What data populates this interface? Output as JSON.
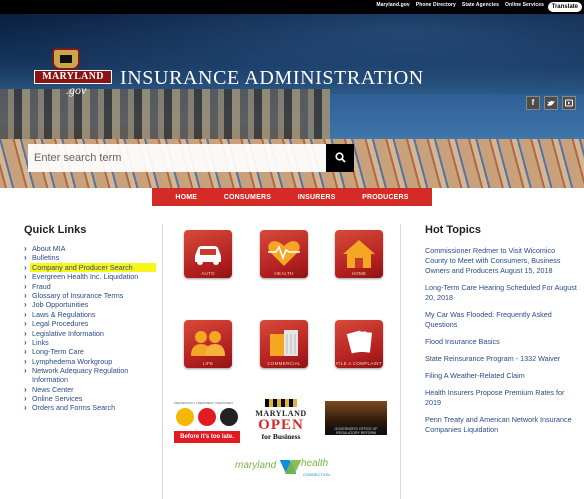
{
  "topbar": {
    "links": [
      "Maryland.gov",
      "Phone Directory",
      "State Agencies",
      "Online Services"
    ],
    "translate_label": "Translate"
  },
  "header": {
    "logo": {
      "wordmark": "MARYLAND",
      "gov": ".gov"
    },
    "site_title": "INSURANCE ADMINISTRATION",
    "social": [
      "f",
      "t",
      "yt"
    ]
  },
  "search": {
    "placeholder": "Enter search term"
  },
  "nav": {
    "items": [
      "HOME",
      "CONSUMERS",
      "INSURERS",
      "PRODUCERS"
    ]
  },
  "quick_links": {
    "heading": "Quick Links",
    "items": [
      {
        "label": "About MIA"
      },
      {
        "label": "Bulletins"
      },
      {
        "label": "Company and Producer Search",
        "highlighted": true
      },
      {
        "label": "Evergreen Health Inc. Liquidation"
      },
      {
        "label": "Fraud"
      },
      {
        "label": "Glossary of Insurance Terms"
      },
      {
        "label": "Job Opportunities"
      },
      {
        "label": "Laws & Regulations"
      },
      {
        "label": "Legal Procedures"
      },
      {
        "label": "Legislative Information"
      },
      {
        "label": "Links"
      },
      {
        "label": "Long-Term Care"
      },
      {
        "label": "Lymphedema Workgroup"
      },
      {
        "label": "Network Adequacy Regulation Information"
      },
      {
        "label": "News Center"
      },
      {
        "label": "Online Services"
      },
      {
        "label": "Orders and Forms Search"
      }
    ]
  },
  "tiles": [
    {
      "label": "AUTO",
      "icon": "car-icon"
    },
    {
      "label": "HEALTH",
      "icon": "heart-icon"
    },
    {
      "label": "HOME",
      "icon": "house-icon"
    },
    {
      "label": "LIFE",
      "icon": "people-icon"
    },
    {
      "label": "COMMERCIAL",
      "icon": "building-icon"
    },
    {
      "label": "FILE A COMPLAINT",
      "icon": "documents-icon"
    }
  ],
  "partners": {
    "bubbles": {
      "strip": "PREVENTION | TREATMENT | RECOVERY",
      "tagline": "Before it's too late."
    },
    "open": {
      "state": "MARYLAND",
      "word": "OPEN",
      "biz": "for Business"
    },
    "photo": {
      "caption": "GOVERNOR'S OFFICE OF REGULATORY REFORM"
    },
    "mhc": {
      "word1": "maryland",
      "word2": "health",
      "sub": "CONNECTION"
    }
  },
  "hot_topics": {
    "heading": "Hot Topics",
    "items": [
      "Commissioner Redmer to Visit Wicomico County to Meet with Consumers, Business Owners and Producers August 15, 2018",
      "Long-Term Care Hearing Scheduled For August 20, 2018",
      "My Car Was Flooded: Frequently Asked Questions",
      "Flood Insurance Basics",
      "State Reinsurance Program - 1332 Waiver",
      "Filing A Weather-Related Claim",
      "Health Insurers Propose Premium Rates for 2019",
      "Penn Treaty and American Network Insurance Companies Liquidation"
    ]
  },
  "colors": {
    "nav_red": "#d52b27",
    "link_blue": "#2a4b8a",
    "highlight": "#f7f51a",
    "tile_red": "#b11f1f"
  }
}
